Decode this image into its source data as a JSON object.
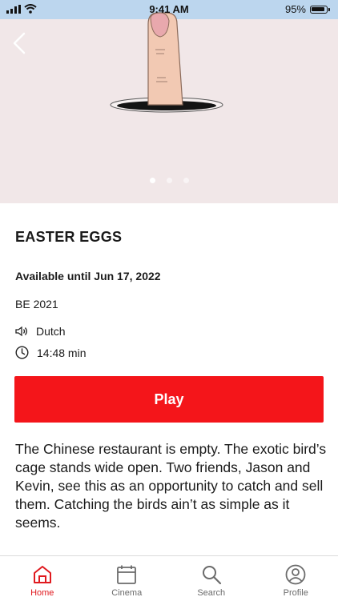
{
  "status_bar": {
    "time": "9:41 AM",
    "battery": "95%"
  },
  "hero": {
    "slides": 3,
    "active_slide": 1
  },
  "detail": {
    "title": "EASTER EGGS",
    "availability": "Available until Jun 17, 2022",
    "origin_year": "BE 2021",
    "language": "Dutch",
    "duration": "14:48 min",
    "play_label": "Play",
    "description": "The Chinese restaurant is empty. The exotic bird’s cage stands wide open. Two friends, Jason and Kevin, see this as an opportunity to catch and sell them. Catching the birds ain’t as simple as it seems."
  },
  "tabs": [
    {
      "label": "Home",
      "icon": "home-icon",
      "active": true
    },
    {
      "label": "Cinema",
      "icon": "calendar-icon",
      "active": false
    },
    {
      "label": "Search",
      "icon": "search-icon",
      "active": false
    },
    {
      "label": "Profile",
      "icon": "profile-icon",
      "active": false
    }
  ],
  "colors": {
    "accent": "#f4151a",
    "tab_active": "#e01a1f",
    "hero_bg": "#f1e7e8"
  }
}
